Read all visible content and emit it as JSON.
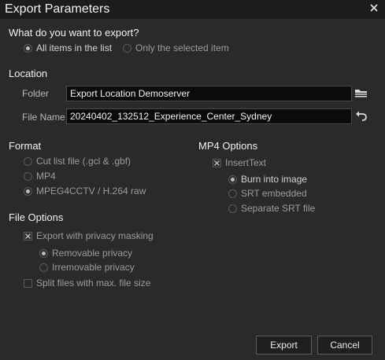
{
  "window": {
    "title": "Export Parameters"
  },
  "export_what": {
    "heading": "What do you want to export?",
    "options": [
      "All items in the list",
      "Only the selected item"
    ],
    "selected": "All items in the list"
  },
  "location": {
    "heading": "Location",
    "folder_label": "Folder",
    "folder_value": "Export Location Demoserver",
    "filename_label": "File Name",
    "filename_value": "20240402_132512_Experience_Center_Sydney"
  },
  "format": {
    "heading": "Format",
    "options": [
      "Cut list file (.gcl & .gbf)",
      "MP4",
      "MPEG4CCTV / H.264 raw"
    ],
    "selected": "MPEG4CCTV / H.264 raw"
  },
  "mp4_options": {
    "heading": "MP4 Options",
    "insert_text_label": "InsertText",
    "insert_text_checked": true,
    "text_options": [
      "Burn into image",
      "SRT embedded",
      "Separate SRT file"
    ],
    "text_selected": "Burn into image"
  },
  "file_options": {
    "heading": "File Options",
    "privacy_label": "Export with privacy masking",
    "privacy_checked": true,
    "privacy_options": [
      "Removable privacy",
      "Irremovable privacy"
    ],
    "privacy_selected": "Removable privacy",
    "split_label": "Split files with max. file size",
    "split_checked": false
  },
  "buttons": {
    "export": "Export",
    "cancel": "Cancel"
  },
  "icons": {
    "close": "close-icon",
    "folder": "folder-browse-icon",
    "reset": "undo-arrow-icon"
  }
}
